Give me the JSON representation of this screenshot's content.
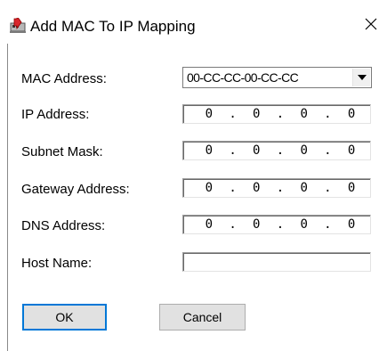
{
  "window": {
    "title": "Add MAC To IP Mapping",
    "close_glyph": "✕",
    "icon": "network-card-icon"
  },
  "form": {
    "mac_label": "MAC Address:",
    "mac_value": "00-CC-CC-00-CC-CC",
    "ip_label": "IP Address:",
    "ip_value": [
      "0",
      "0",
      "0",
      "0"
    ],
    "subnet_label": "Subnet Mask:",
    "subnet_value": [
      "0",
      "0",
      "0",
      "0"
    ],
    "gateway_label": "Gateway Address:",
    "gateway_value": [
      "0",
      "0",
      "0",
      "0"
    ],
    "dns_label": "DNS Address:",
    "dns_value": [
      "0",
      "0",
      "0",
      "0"
    ],
    "host_label": "Host Name:",
    "host_value": ""
  },
  "buttons": {
    "ok_label": "OK",
    "cancel_label": "Cancel"
  },
  "colors": {
    "accent": "#0078d7",
    "icon_red": "#d9262c"
  }
}
